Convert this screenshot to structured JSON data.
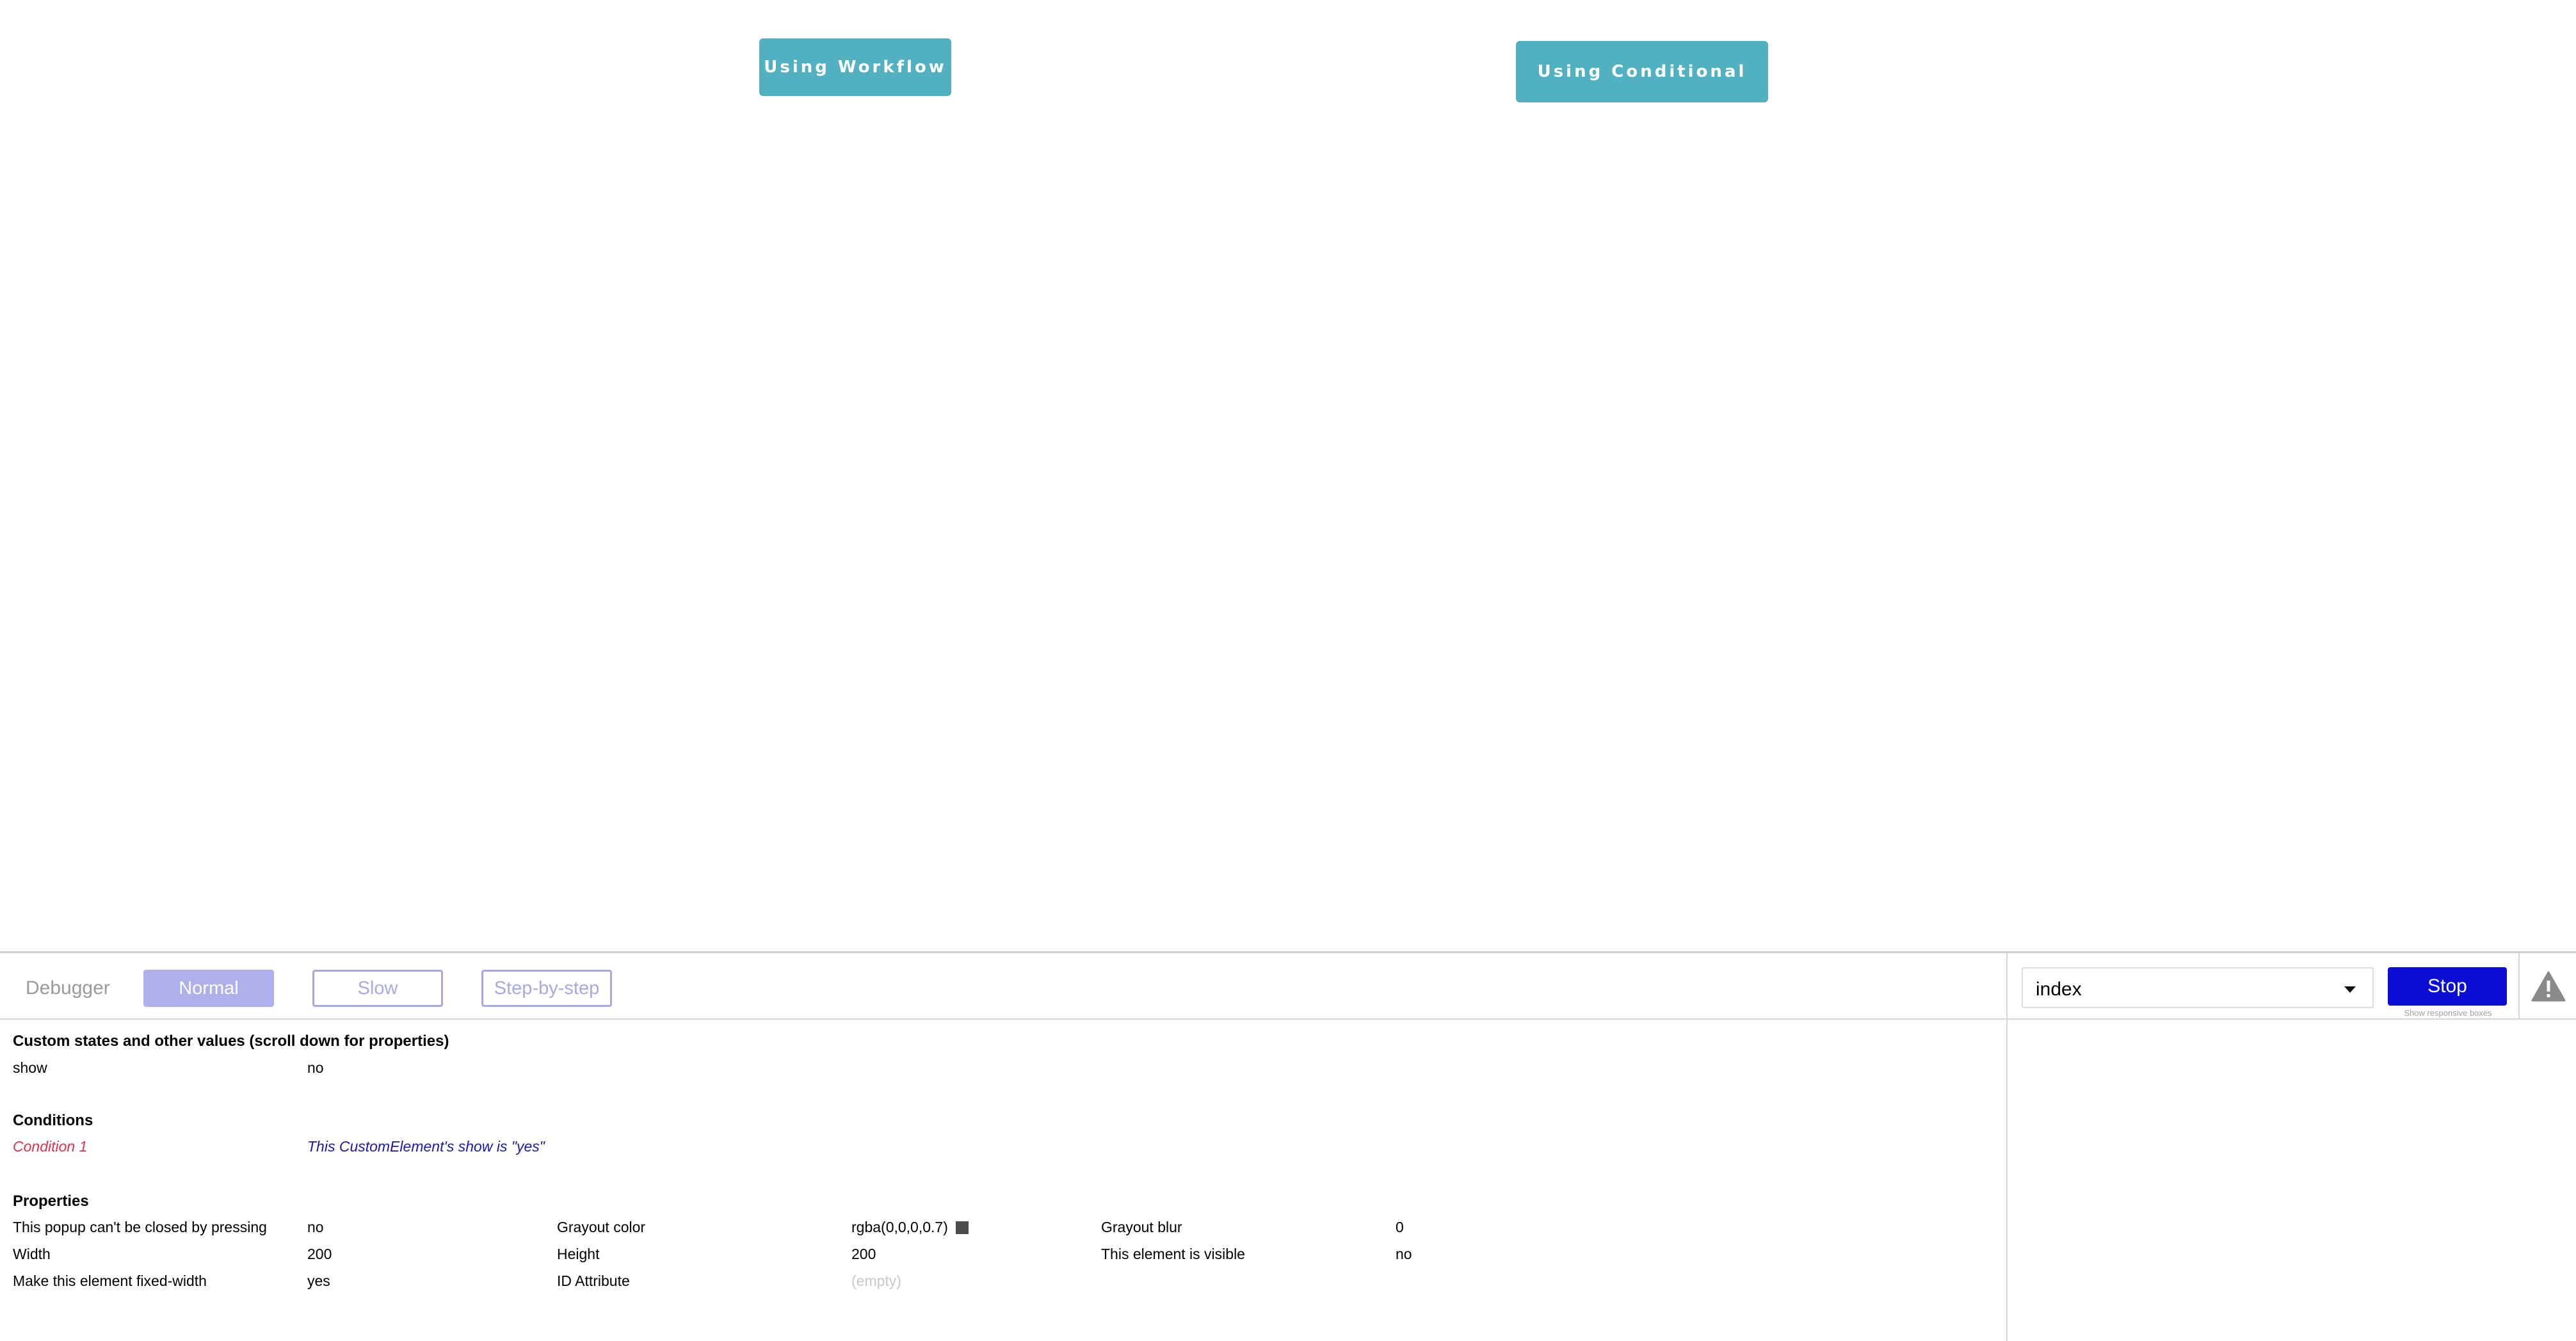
{
  "canvas": {
    "workflow_button": "Using Workflow",
    "conditional_button": "Using Conditional",
    "button_color": "#52b1c1"
  },
  "debugger": {
    "title": "Debugger",
    "modes": [
      "Normal",
      "Slow",
      "Step-by-step"
    ],
    "active_mode": "Normal",
    "page_select": {
      "value": "index"
    },
    "stop_label": "Stop",
    "responsive_label": "Show responsive boxes",
    "warning_icon": "warning-triangle-icon",
    "accent": "#0a0ed4"
  },
  "custom_states": {
    "title": "Custom states and other values (scroll down for properties)",
    "rows": [
      {
        "name": "show",
        "value": "no"
      }
    ]
  },
  "conditions": {
    "title": "Conditions",
    "rows": [
      {
        "name": "Condition 1",
        "value": "This CustomElement's show is \"yes\""
      }
    ]
  },
  "properties": {
    "title": "Properties",
    "rows": [
      [
        {
          "name": "This popup can't be closed by pressing",
          "value": "no"
        },
        {
          "name": "Grayout color",
          "value": "rgba(0,0,0,0.7)"
        },
        {
          "name": "Grayout blur",
          "value": "0"
        }
      ],
      [
        {
          "name": "Width",
          "value": "200"
        },
        {
          "name": "Height",
          "value": "200"
        },
        {
          "name": "This element is visible",
          "value": "no"
        }
      ],
      [
        {
          "name": "Make this element fixed-width",
          "value": "yes"
        },
        {
          "name": "ID Attribute",
          "value": "(empty)"
        }
      ]
    ]
  }
}
